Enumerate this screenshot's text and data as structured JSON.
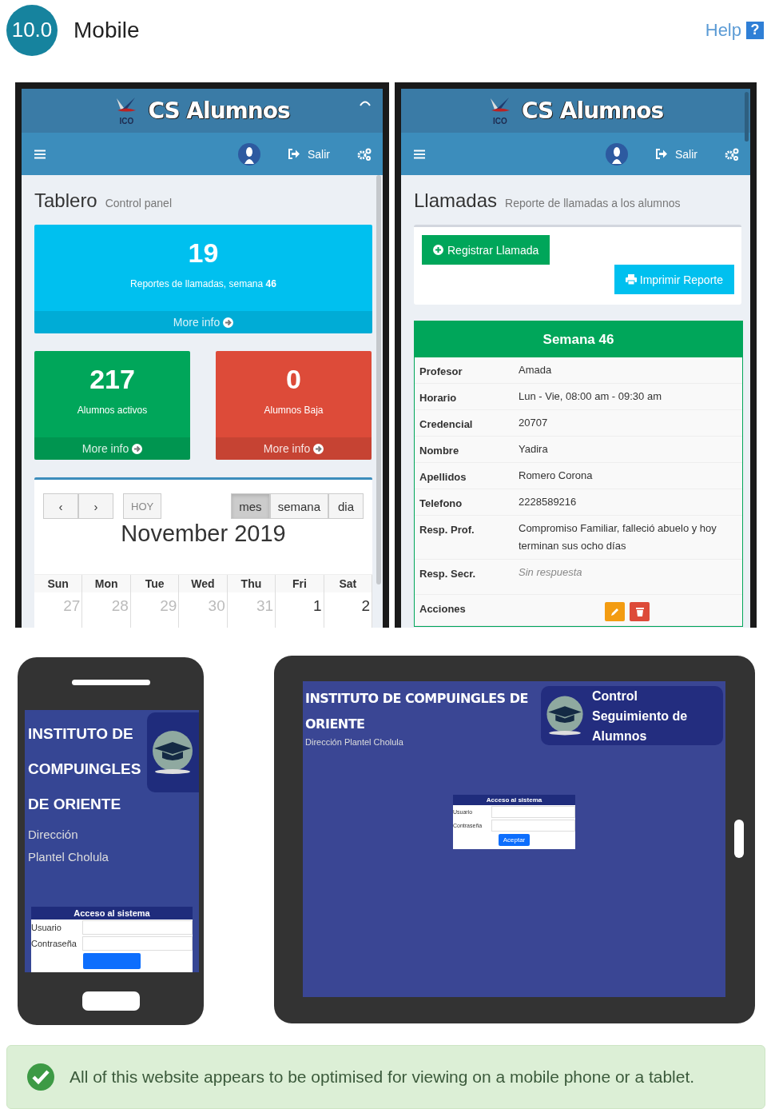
{
  "header": {
    "badge": "10.0",
    "title": "Mobile",
    "help": "Help",
    "help_icon": "?"
  },
  "dashboard_screen": {
    "logo_text": "ICO",
    "app_title": "CS Alumnos",
    "logout": "Salir",
    "page_title": "Tablero",
    "page_subtitle": "Control panel",
    "stat_boxes": [
      {
        "value": "19",
        "label": "Reportes de llamadas, semana **46**",
        "link": "More info",
        "color": "#00c0ef"
      },
      {
        "value": "217",
        "label": "Alumnos activos",
        "link": "More info",
        "color": "#00a65a"
      },
      {
        "value": "0",
        "label": "Alumnos Baja",
        "link": "More info",
        "color": "#dd4b39"
      }
    ],
    "calendar": {
      "prev": "‹",
      "next": "›",
      "today": "HOY",
      "views": [
        {
          "label": "mes",
          "selected": true
        },
        {
          "label": "semana",
          "selected": false
        },
        {
          "label": "dia",
          "selected": false
        }
      ],
      "title": "November 2019",
      "weekdays": [
        "Sun",
        "Mon",
        "Tue",
        "Wed",
        "Thu",
        "Fri",
        "Sat"
      ],
      "days": [
        {
          "label": "27",
          "muted": true
        },
        {
          "label": "28",
          "muted": true
        },
        {
          "label": "29",
          "muted": true
        },
        {
          "label": "30",
          "muted": true
        },
        {
          "label": "31",
          "muted": true
        },
        {
          "label": "1",
          "muted": false
        },
        {
          "label": "2",
          "muted": false
        }
      ]
    }
  },
  "calls_screen": {
    "logo_text": "ICO",
    "app_title": "CS Alumnos",
    "logout": "Salir",
    "page_title": "Llamadas",
    "page_subtitle": "Reporte de llamadas a los alumnos",
    "register_button": "Registrar Llamada",
    "print_button": "Imprimir Reporte",
    "card_title": "Semana 46",
    "rows": [
      {
        "label": "Profesor",
        "value": "Amada",
        "kind": "text"
      },
      {
        "label": "Horario",
        "value": "Lun - Vie, 08:00 am - 09:30 am",
        "kind": "text"
      },
      {
        "label": "Credencial",
        "value": "20707",
        "kind": "text"
      },
      {
        "label": "Nombre",
        "value": "Yadira",
        "kind": "text"
      },
      {
        "label": "Apellidos",
        "value": "Romero Corona",
        "kind": "text"
      },
      {
        "label": "Telefono",
        "value": "2228589216",
        "kind": "text"
      },
      {
        "label": "Resp. Prof.",
        "value": "Compromiso Familiar, falleció abuelo y hoy terminan sus ocho días",
        "kind": "text"
      },
      {
        "label": "Resp. Secr.",
        "placeholder": "Sin respuesta",
        "kind": "empty"
      },
      {
        "label": "Acciones",
        "kind": "actions"
      }
    ]
  },
  "phone_preview": {
    "title": "INSTITUTO DE COMPUINGLES DE ORIENTE",
    "subtitle": "Dirección Plantel Cholula",
    "login_title": "Acceso al sistema",
    "fields": [
      "Usuario",
      "Contraseña"
    ]
  },
  "tablet_preview": {
    "title": "INSTITUTO DE COMPUINGLES DE ORIENTE",
    "subtitle": "Dirección Plantel Cholula",
    "badge": "Control Seguimiento de Alumnos",
    "login_title": "Acceso al sistema",
    "fields": [
      "Usuario",
      "Contraseña"
    ],
    "button": "Aceptar"
  },
  "banner": {
    "text": "All of this website appears to be optimised for viewing on a mobile phone or a tablet."
  }
}
